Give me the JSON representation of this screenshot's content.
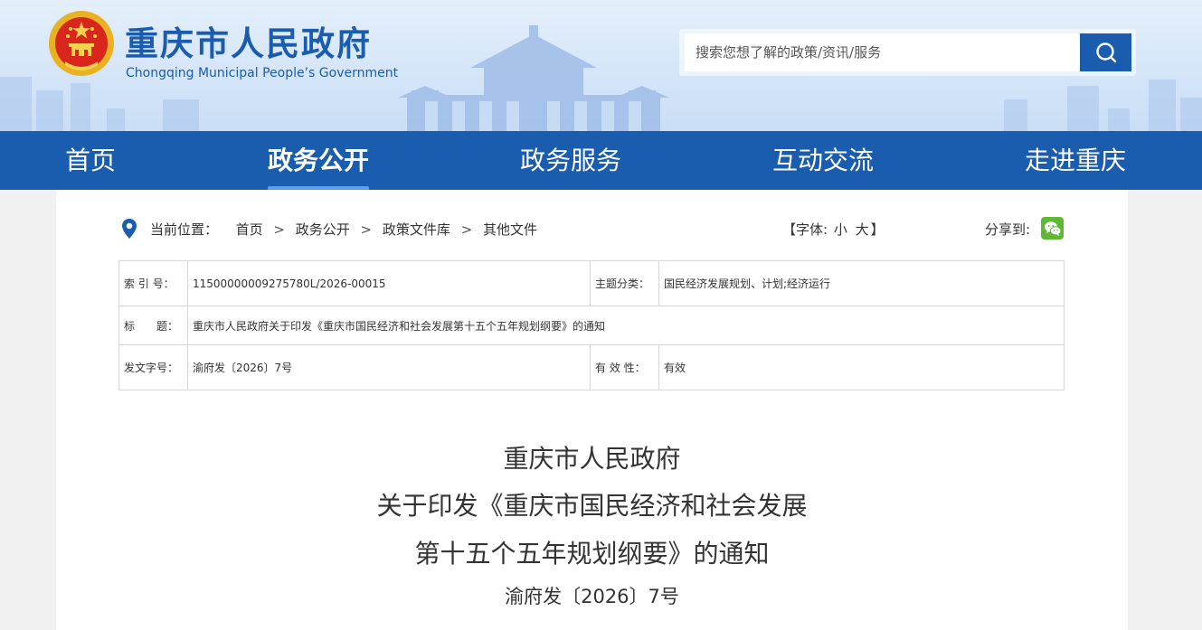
{
  "header": {
    "site_title": "重庆市人民政府",
    "site_subtitle": "Chongqing Municipal People’s Government",
    "search_placeholder": "搜索您想了解的政策/资讯/服务"
  },
  "nav": {
    "items": [
      {
        "label": "首页"
      },
      {
        "label": "政务公开",
        "active": true
      },
      {
        "label": "政务服务"
      },
      {
        "label": "互动交流"
      },
      {
        "label": "走进重庆"
      }
    ]
  },
  "breadcrumb": {
    "prefix": "当前位置：",
    "items": [
      "首页",
      "政务公开",
      "政策文件库",
      "其他文件"
    ],
    "separator": ">"
  },
  "font_control": {
    "open": "【字体:",
    "small": "小",
    "large": "大",
    "close": "】"
  },
  "share": {
    "label": "分享到:",
    "icon": "wechat-icon"
  },
  "meta_table": {
    "index_label": "索 引 号：",
    "index_value": "11500000009275780L/2026-00015",
    "topic_label": "主题分类：",
    "topic_value": "国民经济发展规划、计划;经济运行",
    "title_label": "标　　题：",
    "title_value": "重庆市人民政府关于印发《重庆市国民经济和社会发展第十五个五年规划纲要》的通知",
    "docno_label": "发文字号：",
    "docno_value": "渝府发〔2026〕7号",
    "validity_label": "有 效 性：",
    "validity_value": "有效"
  },
  "document": {
    "title_line1": "重庆市人民政府",
    "title_line2": "关于印发《重庆市国民经济和社会发展",
    "title_line3": "第十五个五年规划纲要》的通知",
    "doc_number": "渝府发〔2026〕7号"
  },
  "colors": {
    "brand_blue": "#1a5cad",
    "nav_active_underline": "#5aa0ee",
    "wechat_green": "#5fb832"
  }
}
